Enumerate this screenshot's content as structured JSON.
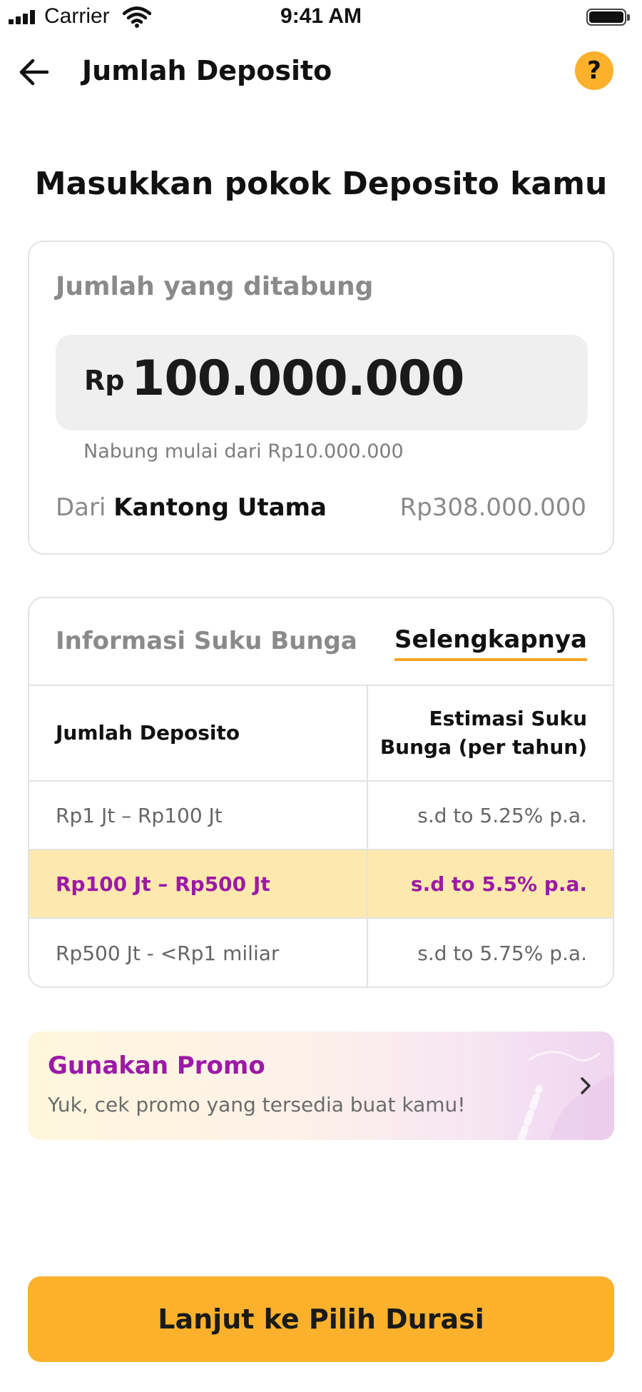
{
  "status_bar": {
    "carrier": "Carrier",
    "time": "9:41 AM",
    "icons": [
      "signal-icon",
      "wifi-icon",
      "battery-icon"
    ]
  },
  "nav": {
    "title": "Jumlah Deposito",
    "back_icon": "arrow-left-icon",
    "help_label": "?"
  },
  "headline": "Masukkan pokok Deposito kamu",
  "amount_card": {
    "label": "Jumlah yang ditabung",
    "currency": "Rp",
    "amount": "100.000.000",
    "min_hint": "Nabung mulai dari Rp10.000.000",
    "source_prefix": "Dari",
    "source_name": "Kantong Utama",
    "source_balance": "Rp308.000.000"
  },
  "rate_info": {
    "title": "Informasi Suku Bunga",
    "more_link": "Selengkapnya",
    "header": {
      "left": "Jumlah Deposito",
      "right": "Estimasi Suku Bunga (per tahun)"
    },
    "rows": [
      {
        "range": "Rp1 Jt – Rp100 Jt",
        "rate": "s.d to 5.25% p.a."
      },
      {
        "range": "Rp100 Jt – Rp500 Jt",
        "rate": "s.d to 5.5% p.a."
      },
      {
        "range": "Rp500 Jt - <Rp1 miliar",
        "rate": "s.d to 5.75% p.a."
      }
    ],
    "highlighted_row": 1
  },
  "promo": {
    "title": "Gunakan Promo",
    "subtitle": "Yuk, cek promo yang tersedia buat kamu!",
    "chevron_icon": "chevron-right-icon"
  },
  "cta": {
    "label": "Lanjut ke Pilih Durasi"
  },
  "colors": {
    "accent": "#fbb12c",
    "promo_text": "#9b1aa6",
    "highlight_row_bg": "#fde9ae",
    "link_underline": "#f5a623"
  }
}
